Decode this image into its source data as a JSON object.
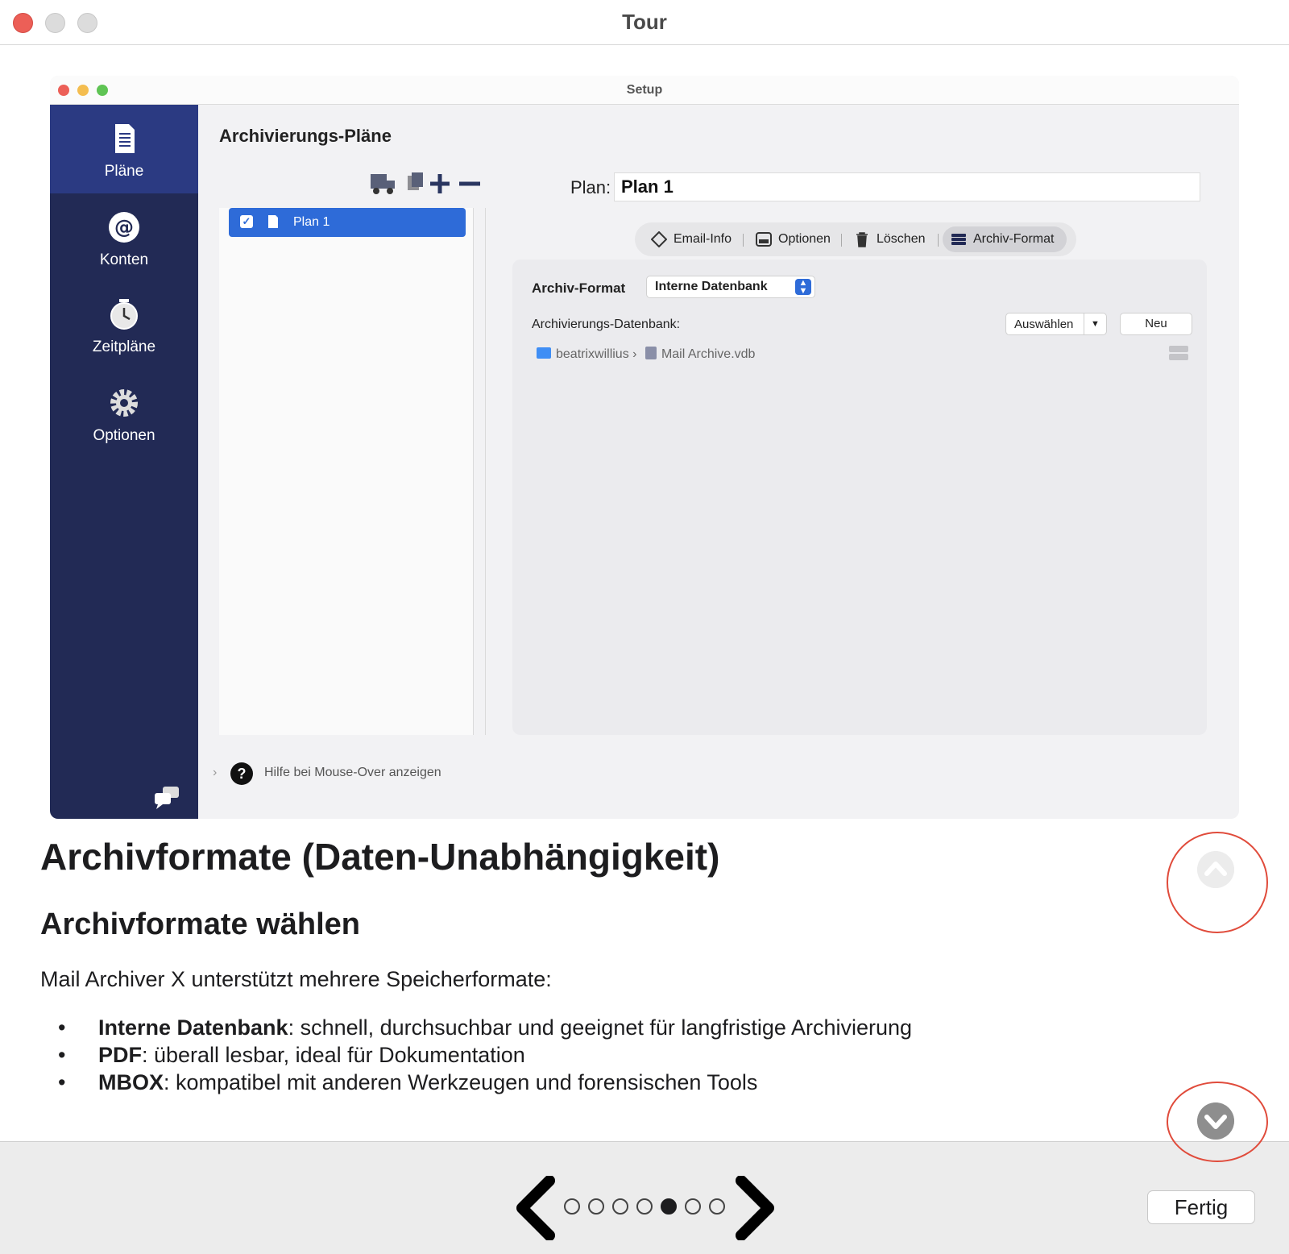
{
  "window": {
    "title": "Tour"
  },
  "screenshot": {
    "title": "Setup",
    "sidebar": {
      "items": [
        {
          "label": "Pläne",
          "icon": "document-icon",
          "active": true
        },
        {
          "label": "Konten",
          "icon": "at-sign-icon",
          "active": false
        },
        {
          "label": "Zeitpläne",
          "icon": "clock-icon",
          "active": false
        },
        {
          "label": "Optionen",
          "icon": "gear-icon",
          "active": false
        }
      ]
    },
    "section_title": "Archivierungs-Pläne",
    "plans": [
      {
        "name": "Plan 1",
        "checked": true
      }
    ],
    "plan_label": "Plan:",
    "plan_value": "Plan 1",
    "tabs": [
      {
        "label": "Email-Info",
        "icon": "diamond-icon"
      },
      {
        "label": "Optionen",
        "icon": "options-icon"
      },
      {
        "label": "Löschen",
        "icon": "trash-icon"
      },
      {
        "label": "Archiv-Format",
        "icon": "database-icon",
        "active": true
      }
    ],
    "format_label": "Archiv-Format",
    "format_value": "Interne Datenbank",
    "db_label": "Archivierungs-Datenbank:",
    "select_button": "Auswählen",
    "new_button": "Neu",
    "path": {
      "folder": "beatrixwillius",
      "separator": "›",
      "file": "Mail Archive.vdb"
    },
    "help_text": "Hilfe bei Mouse-Over anzeigen",
    "help_glyph": "?"
  },
  "tour": {
    "heading": "Archivformate (Daten-Unabhängigkeit)",
    "subheading": "Archivformate wählen",
    "intro": "Mail Archiver X unterstützt mehrere Speicherformate:",
    "bullets": [
      {
        "term": "Interne Datenbank",
        "text": ": schnell, durchsuchbar und geeignet für langfristige Archivierung"
      },
      {
        "term": "PDF",
        "text": ": überall lesbar, ideal für Dokumentation"
      },
      {
        "term": "MBOX",
        "text": ": kompatibel mit anderen Werkzeugen und forensischen Tools"
      }
    ]
  },
  "pagination": {
    "total": 7,
    "current": 5
  },
  "done_button": "Fertig",
  "colors": {
    "sidebar": "#222a55",
    "accent": "#2e6bd8",
    "highlight_circle": "#e04b3b"
  }
}
